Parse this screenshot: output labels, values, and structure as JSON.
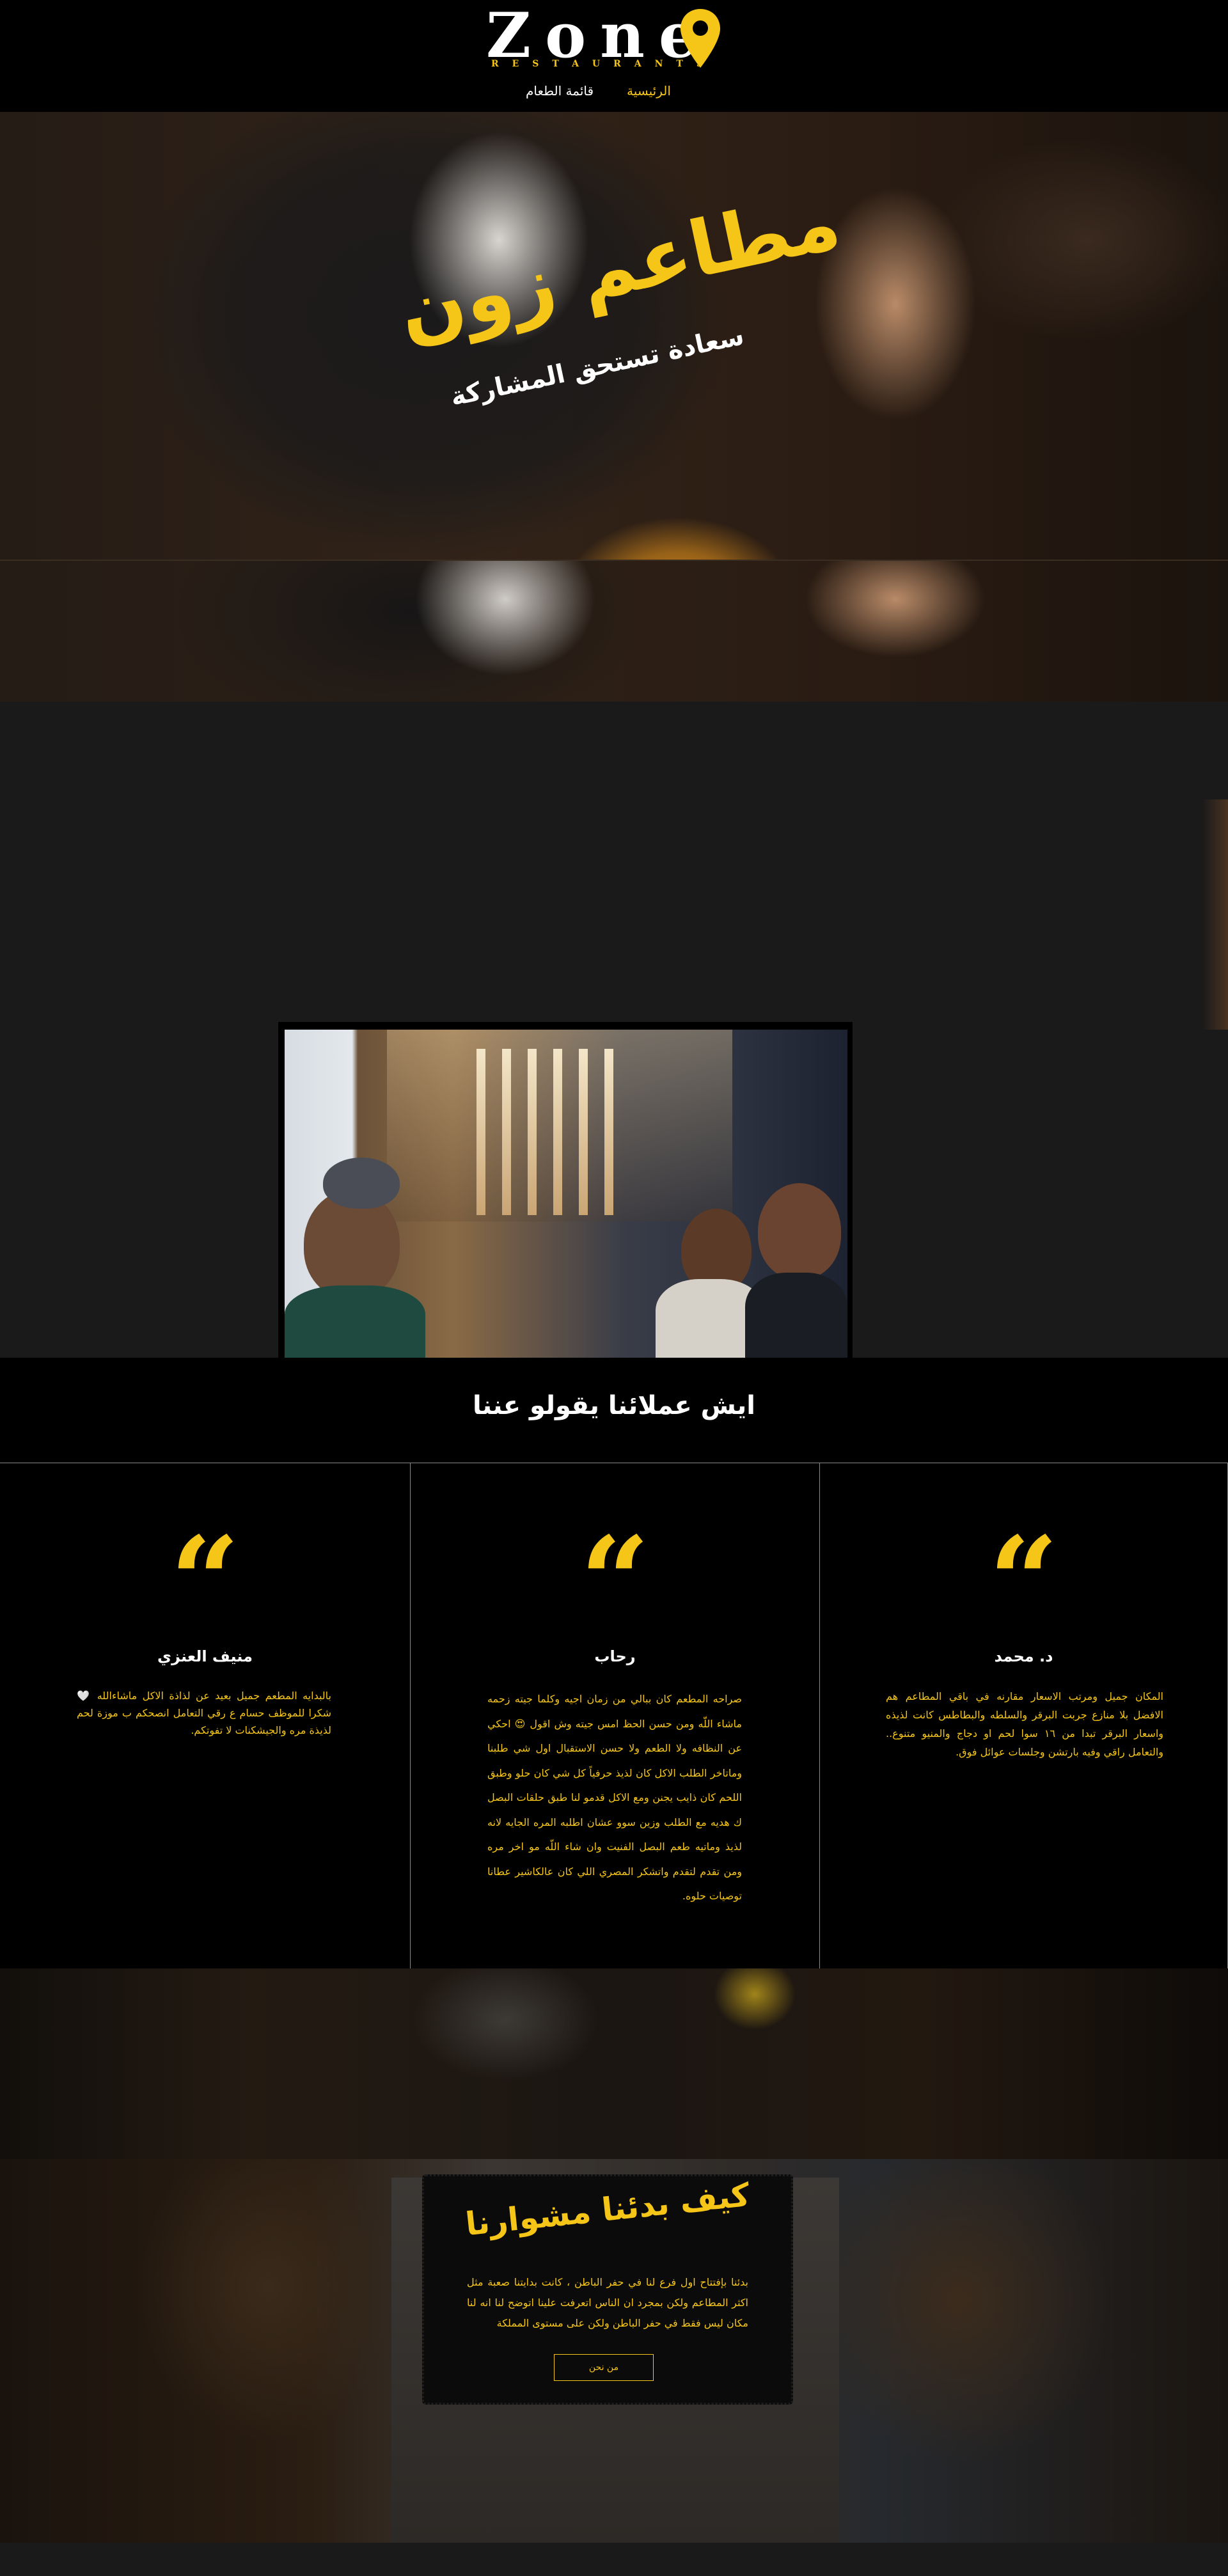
{
  "colors": {
    "accent": "#f5c518",
    "background": "#000000",
    "section_dark": "#1a1a1b",
    "text_light": "#ffffff"
  },
  "header": {
    "logo_word": "Zone",
    "logo_subtitle": "RESTAURANTS",
    "logo_icon": "location-pin-icon",
    "nav": [
      {
        "label": "الرئيسية",
        "active": true
      },
      {
        "label": "قائمة الطعام",
        "active": false
      }
    ]
  },
  "hero": {
    "title": "مطاعم زون",
    "subtitle": "سعادة تستحق المشاركة"
  },
  "testimonials": {
    "heading": "ايش عملائنا يقولو عننا",
    "quote_icon": "quote-icon",
    "items": [
      {
        "name": "منيف العنزي",
        "text": "بالبدايه المطعم جميل بعيد عن لذاذة الاكل ماشاءالله 🤍 شكرا للموظف حسام ع رقي التعامل انصحكم ب موزة لحم لذيذة مره والجيشكنات لا تفوتكم."
      },
      {
        "name": "رحاب",
        "text": "صراحه المطعم كان ببالي من زمان اجيه وكلما جيته زحمه ماشاء اللّه ومن حسن الحظ امس جيته وش اقول 😍 احكي عن النظافه ولا الطعم ولا حسن الاستقبال اول شي طلبنا وماتاخر الطلب الاكل كان لذيذ حرفياً كل شي كان حلو وطبق اللحم كان ذايب يجنن ومع الاكل قدمو لنا طبق حلقات البصل ك هديه مع الطلب وزين سوو عشان اطلبه المره الجايه لانه لذيذ وماتيه طعم البصل الفنيت وان شاء اللّه مو اخر مره ومن تقدم لتقدم واتشكر المصري اللي كان عالكاشير عطانا توصيات حلوه."
      },
      {
        "name": "د. محمد",
        "text": "المكان جميل ومرتب الاسعار مقارنه في باقي المطاعم هم الافضل بلا منازع جربت البرقر والسلطه والبطاطس كانت لذيذه واسعار البرقر تبدا من ١٦ سوا لحم او دجاج والمنيو متنوع.. والتعامل راقي وفيه بارتشن وجلسات عوائل فوق."
      }
    ]
  },
  "story": {
    "title": "كيف بدئنا مشوارنا",
    "text": "بدئنا بإفتتاح اول فرع لنا في حفر الباطن ، كانت بدايتنا صعبة مثل اكثر المطاعم ولكن بمجرد ان الناس اتعرفت علينا اتوضح لنا انه لنا مكان ليس فقط في حفر الباطن ولكن على مستوى المملكة",
    "button_label": "من نحن"
  }
}
